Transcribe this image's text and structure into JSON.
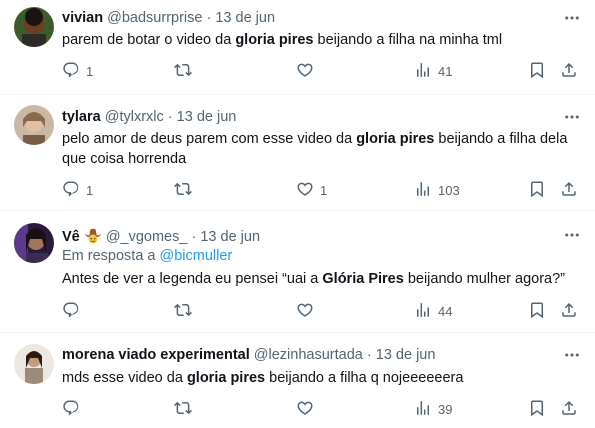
{
  "tweets": [
    {
      "name": "vivian",
      "handle": "@badsurrprise",
      "sep": "·",
      "date": "13 de jun",
      "text_parts": [
        "parem de botar o video da ",
        "gloria pires",
        " beijando a filha na minha tml"
      ],
      "reply_count": "1",
      "retweet_count": "",
      "like_count": "",
      "view_count": "41"
    },
    {
      "name": "tylara",
      "handle": "@tylxrxlc",
      "sep": "·",
      "date": "13 de jun",
      "text_parts": [
        "pelo amor de deus parem com esse video da ",
        "gloria pires",
        " beijando a filha dela que coisa horrenda"
      ],
      "reply_count": "1",
      "retweet_count": "",
      "like_count": "1",
      "view_count": "103"
    },
    {
      "name": "Vê",
      "handle": "@_vgomes_",
      "sep": "·",
      "date": "13 de jun",
      "reply_prefix": "Em resposta a ",
      "reply_to": "@bicmuller",
      "text_parts": [
        "Antes de ver a legenda eu pensei “uai a ",
        "Glória Pires",
        " beijando mulher agora?”"
      ],
      "reply_count": "",
      "retweet_count": "",
      "like_count": "",
      "view_count": "44"
    },
    {
      "name": "morena viado experimental",
      "handle": "@lezinhasurtada",
      "sep": "·",
      "date": "13 de jun",
      "text_parts": [
        "mds esse video da ",
        "gloria pires",
        " beijando a filha q nojeeeeeera"
      ],
      "reply_count": "",
      "retweet_count": "",
      "like_count": "",
      "view_count": "39"
    }
  ],
  "colors": {
    "text": "#0f1419",
    "muted": "#536471",
    "link": "#1d9bf0",
    "divider": "#eff3f4"
  },
  "icons": [
    "more-icon",
    "reply-icon",
    "retweet-icon",
    "like-icon",
    "views-icon",
    "bookmark-icon",
    "share-icon",
    "cowboy-emoji"
  ]
}
